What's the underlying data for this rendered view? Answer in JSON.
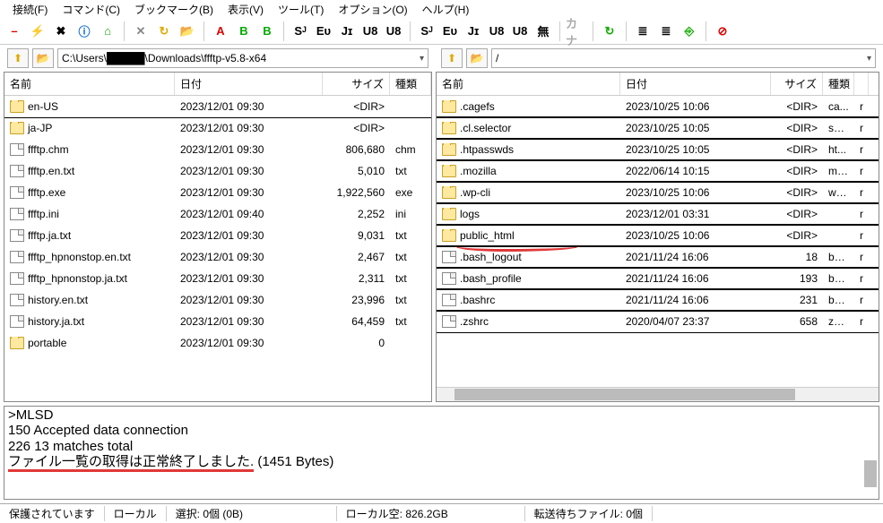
{
  "menu": [
    "接続(F)",
    "コマンド(C)",
    "ブックマーク(B)",
    "表示(V)",
    "ツール(T)",
    "オプション(O)",
    "ヘルプ(H)"
  ],
  "tb": [
    "–",
    "⚡",
    "✖",
    "ⓘ",
    "⌂",
    "",
    "✕",
    "↻",
    "📂",
    "",
    "A",
    "B",
    "B",
    "",
    "Sᴶ",
    "Eᴜ",
    "Jɪ",
    "U8",
    "U8",
    "",
    "Sᴶ",
    "Eᴜ",
    "Jɪ",
    "U8",
    "U8",
    "無",
    "",
    "カナ",
    "",
    "↻",
    "",
    "≣",
    "≣",
    "⎆",
    "",
    "⊘"
  ],
  "tbColors": [
    "#d00",
    "#da0",
    "#000",
    "#06c",
    "#1a0",
    "",
    "#888",
    "#da0",
    "#da0",
    "",
    "#d00",
    "#0a0",
    "#0a0",
    "",
    "#000",
    "#000",
    "#000",
    "#000",
    "#000",
    "",
    "#000",
    "#000",
    "#000",
    "#000",
    "#000",
    "#000",
    "",
    "#aaa",
    "",
    "#1a0",
    "",
    "#000",
    "#000",
    "#1a0",
    "",
    "#d00"
  ],
  "pathLeft": "C:\\Users\\█████\\Downloads\\ffftp-v5.8-x64",
  "pathRight": "/",
  "cols": [
    "名前",
    "日付",
    "サイズ",
    "種類"
  ],
  "leftRows": [
    [
      "folder",
      "en-US",
      "2023/12/01 09:30",
      "<DIR>",
      "",
      true
    ],
    [
      "folder",
      "ja-JP",
      "2023/12/01 09:30",
      "<DIR>",
      "",
      false
    ],
    [
      "file",
      "ffftp.chm",
      "2023/12/01 09:30",
      "806,680",
      "chm",
      false
    ],
    [
      "file",
      "ffftp.en.txt",
      "2023/12/01 09:30",
      "5,010",
      "txt",
      false
    ],
    [
      "file",
      "ffftp.exe",
      "2023/12/01 09:30",
      "1,922,560",
      "exe",
      false
    ],
    [
      "file",
      "ffftp.ini",
      "2023/12/01 09:40",
      "2,252",
      "ini",
      false
    ],
    [
      "file",
      "ffftp.ja.txt",
      "2023/12/01 09:30",
      "9,031",
      "txt",
      false
    ],
    [
      "file",
      "ffftp_hpnonstop.en.txt",
      "2023/12/01 09:30",
      "2,467",
      "txt",
      false
    ],
    [
      "file",
      "ffftp_hpnonstop.ja.txt",
      "2023/12/01 09:30",
      "2,311",
      "txt",
      false
    ],
    [
      "file",
      "history.en.txt",
      "2023/12/01 09:30",
      "23,996",
      "txt",
      false
    ],
    [
      "file",
      "history.ja.txt",
      "2023/12/01 09:30",
      "64,459",
      "txt",
      false
    ],
    [
      "folder",
      "portable",
      "2023/12/01 09:30",
      "0",
      "",
      false
    ]
  ],
  "rightRows": [
    [
      "folder",
      ".cagefs",
      "2023/10/25 10:06",
      "<DIR>",
      "ca...",
      "r"
    ],
    [
      "folder",
      ".cl.selector",
      "2023/10/25 10:05",
      "<DIR>",
      "sel...",
      "r"
    ],
    [
      "folder",
      ".htpasswds",
      "2023/10/25 10:05",
      "<DIR>",
      "ht...",
      "r"
    ],
    [
      "folder",
      ".mozilla",
      "2022/06/14 10:15",
      "<DIR>",
      "mo...",
      "r"
    ],
    [
      "folder",
      ".wp-cli",
      "2023/10/25 10:06",
      "<DIR>",
      "wp...",
      "r"
    ],
    [
      "folder",
      "logs",
      "2023/12/01 03:31",
      "<DIR>",
      "",
      "r"
    ],
    [
      "folder",
      "public_html",
      "2023/10/25 10:06",
      "<DIR>",
      "",
      "r"
    ],
    [
      "file",
      ".bash_logout",
      "2021/11/24 16:06",
      "18",
      "ba...",
      "r"
    ],
    [
      "file",
      ".bash_profile",
      "2021/11/24 16:06",
      "193",
      "ba...",
      "r"
    ],
    [
      "file",
      ".bashrc",
      "2021/11/24 16:06",
      "231",
      "ba...",
      "r"
    ],
    [
      "file",
      ".zshrc",
      "2020/04/07 23:37",
      "658",
      "zsh...",
      "r"
    ]
  ],
  "log": {
    "l1": ">MLSD",
    "l2": "150 Accepted data connection",
    "l3": "226 13 matches total",
    "l4a": "ファイル一覧の取得は正常終了しました.",
    "l4b": " (1451 Bytes)"
  },
  "status": [
    "保護されています",
    "ローカル",
    "選択: 0個 (0B)",
    "ローカル空: 826.2GB",
    "転送待ちファイル: 0個"
  ]
}
